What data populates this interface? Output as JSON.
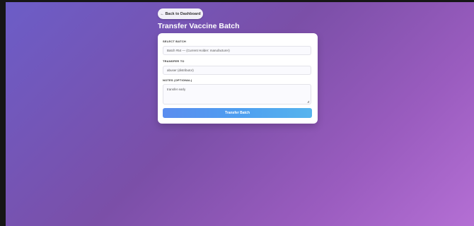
{
  "header": {
    "back_label": "← Back to Dashboard",
    "title": "Transfer Vaccine Batch"
  },
  "form": {
    "batch": {
      "label": "SELECT BATCH",
      "value": "Batch #54 — (Current Holder: manufacturer)"
    },
    "transfer_to": {
      "label": "TRANSFER TO",
      "value": "abuser (distributor)"
    },
    "notes": {
      "label": "NOTES (OPTIONAL)",
      "value": "transfer early"
    },
    "submit_label": "Transfer Batch"
  },
  "colors": {
    "background_start": "#6c5dc7",
    "background_end": "#b46fd4",
    "button_start": "#5b8def",
    "button_end": "#56b4ee"
  }
}
